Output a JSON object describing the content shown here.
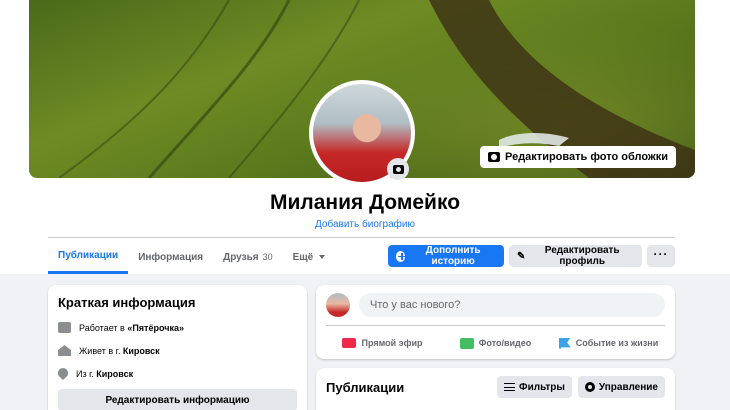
{
  "profile": {
    "name": "Милания Домейко",
    "add_bio": "Добавить биографию",
    "edit_cover": "Редактировать фото обложки"
  },
  "tabs": [
    {
      "label": "Публикации",
      "active": true
    },
    {
      "label": "Информация"
    },
    {
      "label": "Друзья",
      "count": "30"
    },
    {
      "label": "Ещё"
    }
  ],
  "actions": {
    "add_story": "Дополнить историю",
    "edit_profile": "Редактировать профиль"
  },
  "intro": {
    "title": "Краткая информация",
    "work_prefix": "Работает в ",
    "work_place": "«Пятёрочка»",
    "lives_prefix": "Живет в г. ",
    "lives_city": "Кировск",
    "from_prefix": "Из г. ",
    "from_city": "Кировск",
    "edit_button": "Редактировать информацию"
  },
  "composer": {
    "placeholder": "Что у вас нового?",
    "live": "Прямой эфир",
    "photo": "Фото/видео",
    "life_event": "Событие из жизни"
  },
  "posts": {
    "title": "Публикации",
    "filters": "Фильтры",
    "manage": "Управление"
  },
  "colors": {
    "accent": "#1877f2",
    "background": "#f0f2f5",
    "live": "#f02849",
    "photo": "#45bd62",
    "event": "#3ea3e6"
  }
}
